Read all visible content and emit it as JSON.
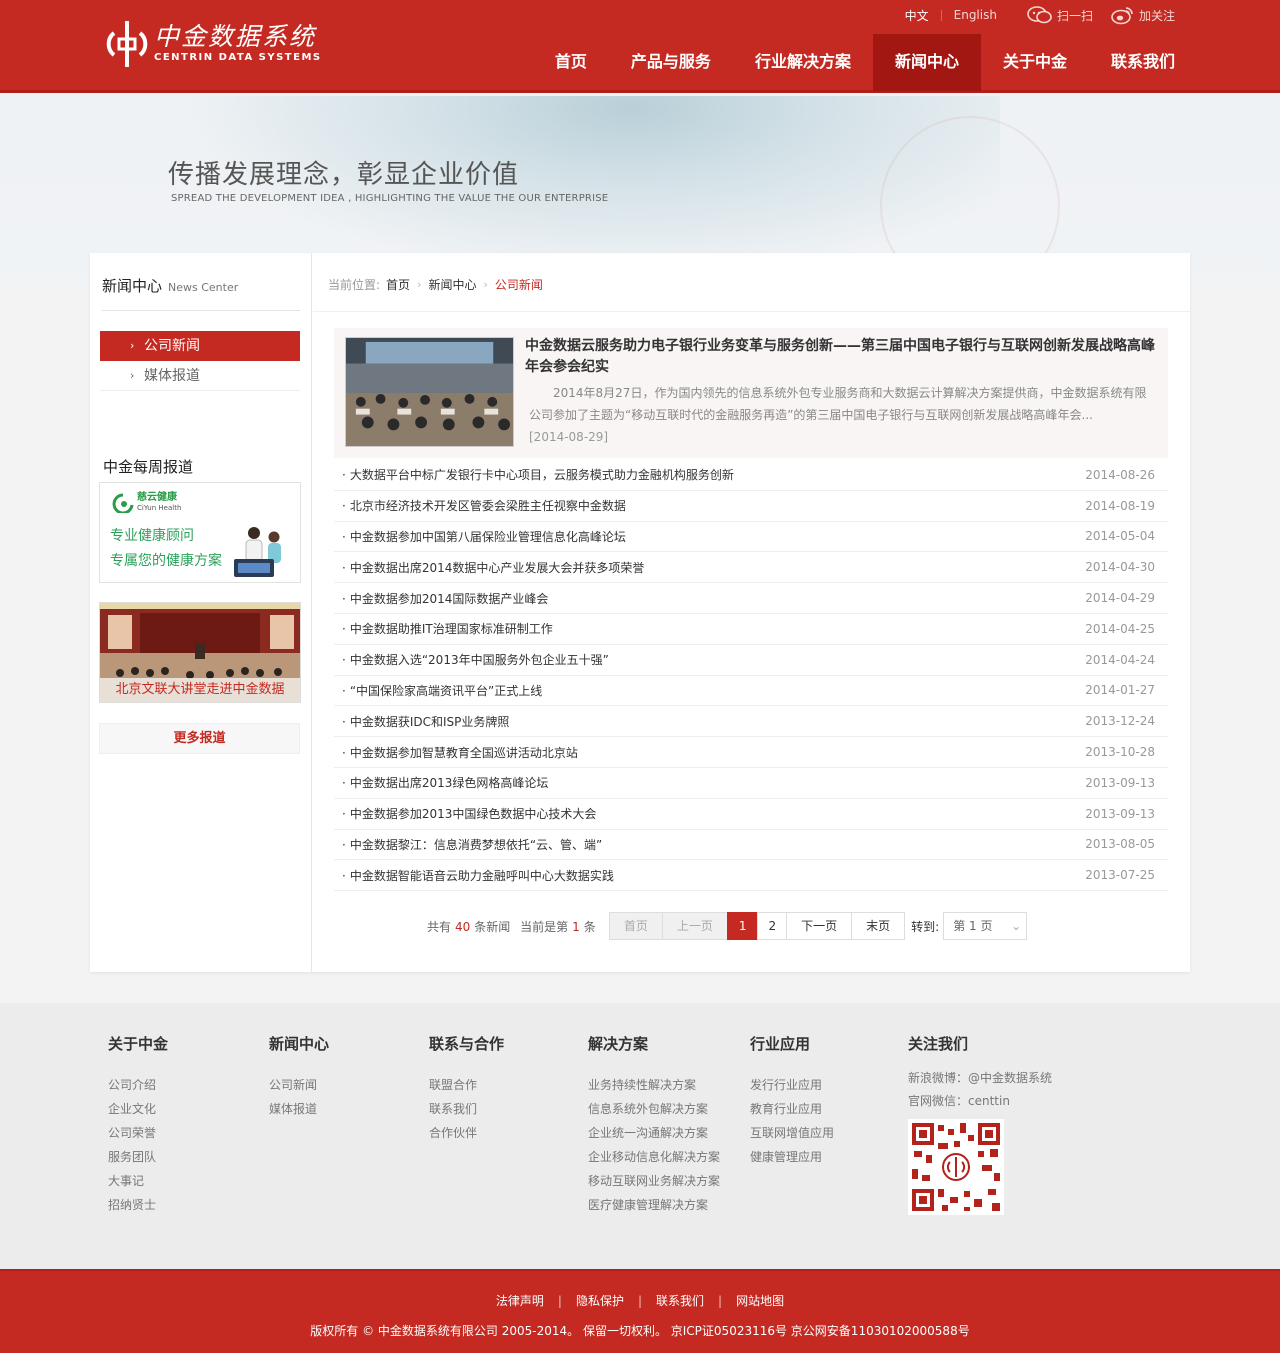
{
  "header": {
    "logo_cn": "中金数据系统",
    "logo_en": "CENTRIN DATA SYSTEMS",
    "lang_cn": "中文",
    "lang_en": "English",
    "wechat_label": "扫一扫",
    "weibo_label": "加关注",
    "nav": [
      "首页",
      "产品与服务",
      "行业解决方案",
      "新闻中心",
      "关于中金",
      "联系我们"
    ],
    "nav_active": "新闻中心"
  },
  "banner": {
    "title": "传播发展理念，彰显企业价值",
    "subtitle": "SPREAD THE DEVELOPMENT IDEA , HIGHLIGHTING THE VALUE THE OUR ENTERPRISE"
  },
  "sidebar": {
    "title_cn": "新闻中心",
    "title_en": "News Center",
    "menu": [
      "公司新闻",
      "媒体报道"
    ],
    "weekly_title": "中金每周报道",
    "ad1": {
      "brand": "慈云健康",
      "brand_en": "CiYun Health",
      "line1": "专业健康顾问",
      "line2": "专属您的健康方案"
    },
    "ad2_caption": "北京文联大讲堂走进中金数据",
    "more": "更多报道"
  },
  "breadcrumb": {
    "label": "当前位置:",
    "items": [
      "首页",
      "新闻中心",
      "公司新闻"
    ]
  },
  "featured": {
    "title": "中金数据云服务助力电子银行业务变革与服务创新——第三届中国电子银行与互联网创新发展战略高峰年会参会纪实",
    "desc": "2014年8月27日，作为国内领先的信息系统外包专业服务商和大数据云计算解决方案提供商，中金数据系统有限公司参加了主题为“移动互联时代的金融服务再造”的第三届中国电子银行与互联网创新发展战略高峰年会...",
    "date": "[2014-08-29]"
  },
  "news": [
    {
      "title": "大数据平台中标广发银行卡中心项目，云服务模式助力金融机构服务创新",
      "date": "2014-08-26"
    },
    {
      "title": "北京市经济技术开发区管委会梁胜主任视察中金数据",
      "date": "2014-08-19"
    },
    {
      "title": "中金数据参加中国第八届保险业管理信息化高峰论坛",
      "date": "2014-05-04"
    },
    {
      "title": "中金数据出席2014数据中心产业发展大会并获多项荣誉",
      "date": "2014-04-30"
    },
    {
      "title": "中金数据参加2014国际数据产业峰会",
      "date": "2014-04-29"
    },
    {
      "title": "中金数据助推IT治理国家标准研制工作",
      "date": "2014-04-25"
    },
    {
      "title": "中金数据入选“2013年中国服务外包企业五十强”",
      "date": "2014-04-24"
    },
    {
      "title": "“中国保险家高端资讯平台”正式上线",
      "date": "2014-01-27"
    },
    {
      "title": "中金数据获IDC和ISP业务牌照",
      "date": "2013-12-24"
    },
    {
      "title": "中金数据参加智慧教育全国巡讲活动北京站",
      "date": "2013-10-28"
    },
    {
      "title": "中金数据出席2013绿色网格高峰论坛",
      "date": "2013-09-13"
    },
    {
      "title": "中金数据参加2013中国绿色数据中心技术大会",
      "date": "2013-09-13"
    },
    {
      "title": "中金数据黎江：信息消费梦想依托“云、管、端”",
      "date": "2013-08-05"
    },
    {
      "title": "中金数据智能语音云助力金融呼叫中心大数据实践",
      "date": "2013-07-25"
    }
  ],
  "pager": {
    "total_prefix": "共有",
    "total": "40",
    "total_suffix": "条新闻",
    "current_prefix": "当前是第",
    "current": "1",
    "current_suffix": "条",
    "first": "首页",
    "prev": "上一页",
    "pages": [
      "1",
      "2"
    ],
    "next": "下一页",
    "last": "末页",
    "jump_label": "转到:",
    "jump_value": "第 1 页"
  },
  "footer": {
    "cols": [
      {
        "title": "关于中金",
        "links": [
          "公司介绍",
          "企业文化",
          "公司荣誉",
          "服务团队",
          "大事记",
          "招纳贤士"
        ]
      },
      {
        "title": "新闻中心",
        "links": [
          "公司新闻",
          "媒体报道"
        ]
      },
      {
        "title": "联系与合作",
        "links": [
          "联盟合作",
          "联系我们",
          "合作伙伴"
        ]
      },
      {
        "title": "解决方案",
        "links": [
          "业务持续性解决方案",
          "信息系统外包解决方案",
          "企业统一沟通解决方案",
          "企业移动信息化解决方案",
          "移动互联网业务解决方案",
          "医疗健康管理解决方案"
        ]
      },
      {
        "title": "行业应用",
        "links": [
          "发行行业应用",
          "教育行业应用",
          "互联网增值应用",
          "健康管理应用"
        ]
      }
    ],
    "follow_title": "关注我们",
    "weibo": "新浪微博：@中金数据系统",
    "wechat": "官网微信：centtin"
  },
  "bottom": {
    "links": [
      "法律声明",
      "隐私保护",
      "联系我们",
      "网站地图"
    ],
    "copyright": "版权所有 © 中金数据系统有限公司 2005-2014。 保留一切权利。 京ICP证05023116号 京公网安备11030102000588号"
  },
  "colors": {
    "brand_red": "#c42a22",
    "dark_red": "#a21711",
    "health_green": "#2aa25a"
  }
}
